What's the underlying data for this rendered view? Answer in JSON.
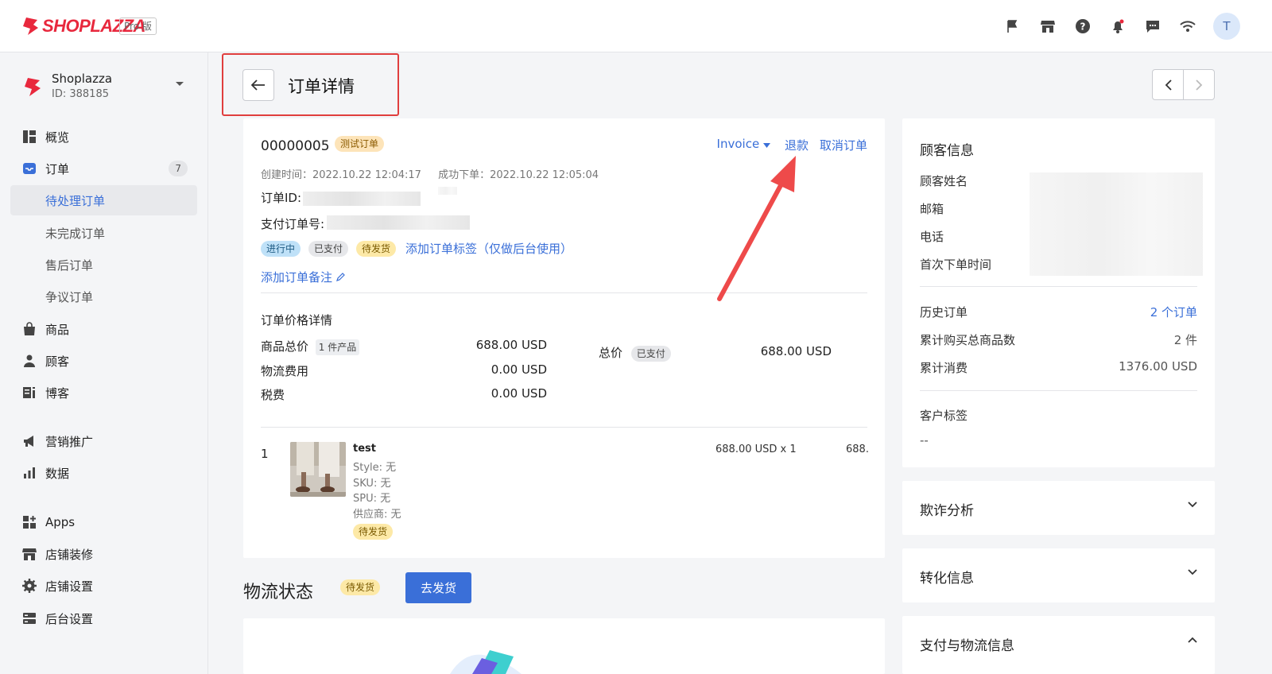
{
  "brand": {
    "name": "SHOPLAZZA",
    "edition": "Pro 版"
  },
  "topbar_icons": [
    "flag-icon",
    "store-icon",
    "help-icon",
    "bell-icon",
    "chat-icon",
    "wifi-icon"
  ],
  "user": {
    "avatar": "T"
  },
  "store": {
    "name": "Shoplazza",
    "id": "ID: 388185"
  },
  "nav": {
    "overview": "概览",
    "orders": "订单",
    "orders_count": "7",
    "pending": "待处理订单",
    "incomplete": "未完成订单",
    "aftersale": "售后订单",
    "dispute": "争议订单",
    "products": "商品",
    "customers": "顾客",
    "blog": "博客",
    "marketing": "营销推广",
    "analytics": "数据",
    "apps": "Apps",
    "theme": "店铺装修",
    "store_settings": "店铺设置",
    "admin_settings": "后台设置"
  },
  "page": {
    "title": "订单详情"
  },
  "order": {
    "number": "00000005",
    "test_badge": "测试订单",
    "invoice": "Invoice",
    "refund": "退款",
    "cancel": "取消订单",
    "created": "创建时间：2022.10.22 12:04:17",
    "placed": "成功下单：2022.10.22 12:05:04",
    "order_id_label": "订单ID:",
    "payment_no_label": "支付订单号:",
    "status_tags": [
      "进行中",
      "已支付",
      "待发货"
    ],
    "add_tag": "添加订单标签（仅做后台使用）",
    "add_remark": "添加订单备注"
  },
  "price": {
    "title": "订单价格详情",
    "subtotal_label": "商品总价",
    "subtotal_count": "1 件产品",
    "subtotal": "688.00 USD",
    "shipping_label": "物流费用",
    "shipping": "0.00 USD",
    "tax_label": "税费",
    "tax": "0.00 USD",
    "total_label": "总价",
    "total_status": "已支付",
    "total": "688.00 USD"
  },
  "item": {
    "index": "1",
    "name": "test",
    "style": "Style: 无",
    "sku": "SKU: 无",
    "spu": "SPU: 无",
    "vendor": "供应商: 无",
    "status": "待发货",
    "unit_price": "688.00 USD x 1",
    "total": "688."
  },
  "shipping": {
    "title": "物流状态",
    "status": "待发货",
    "button": "去发货"
  },
  "customer": {
    "title": "顾客信息",
    "name_label": "顾客姓名",
    "email_label": "邮箱",
    "phone_label": "电话",
    "first_order_label": "首次下单时间",
    "history_label": "历史订单",
    "history": "2 个订单",
    "items_label": "累计购买总商品数",
    "items": "2 件",
    "spent_label": "累计消费",
    "spent": "1376.00 USD",
    "tags_label": "客户标签",
    "tags": "--"
  },
  "panels": {
    "fraud": "欺诈分析",
    "conversion": "转化信息",
    "payment": "支付与物流信息"
  },
  "colors": {
    "accent": "#3a6fd8",
    "brand": "#e8283d",
    "highlight": "#e03e3e"
  }
}
